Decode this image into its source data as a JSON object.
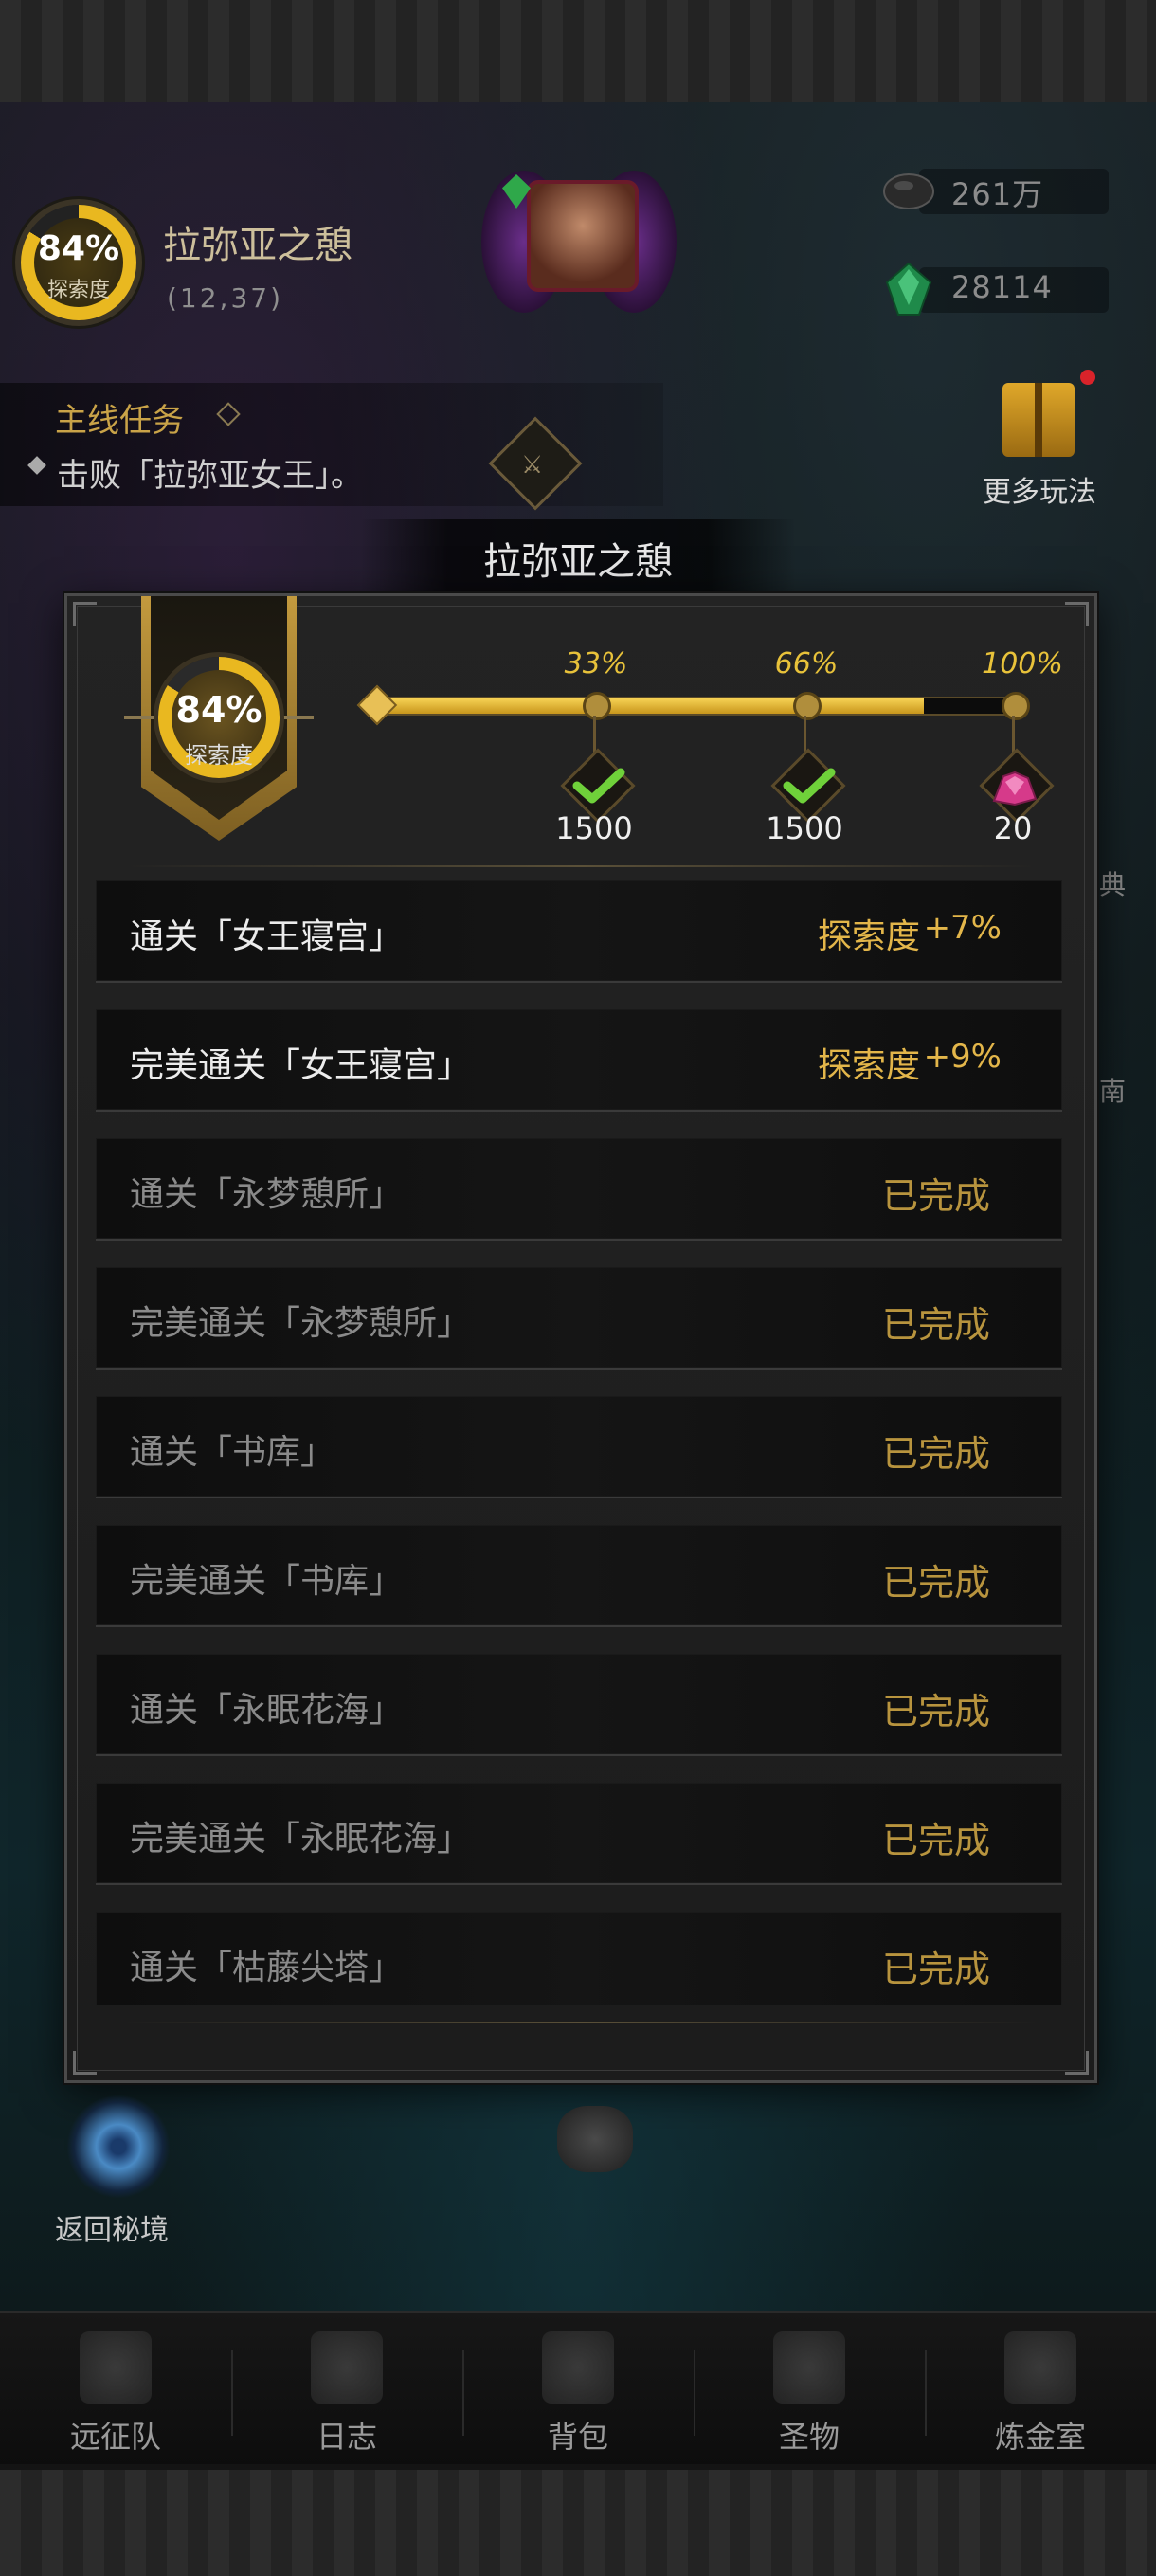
{
  "header": {
    "explore_pct": "84%",
    "explore_label": "探索度",
    "zone_name": "拉弥亚之憩",
    "zone_coords": "(12,37)",
    "currency_1": "261万",
    "currency_2": "28114"
  },
  "quest": {
    "title": "主线任务",
    "desc": "击败「拉弥亚女王」。"
  },
  "side": {
    "more_play_label": "更多玩法",
    "frag_1": "典",
    "frag_2": "南"
  },
  "dialog": {
    "title": "拉弥亚之憩",
    "explore_pct": "84%",
    "explore_label": "探索度",
    "progress": 0.84,
    "milestones": [
      {
        "pct": "33%",
        "qty": "1500",
        "claimed": true
      },
      {
        "pct": "66%",
        "qty": "1500",
        "claimed": true
      },
      {
        "pct": "100%",
        "qty": "20",
        "claimed": false
      }
    ],
    "reward_label": "探索度",
    "tasks": [
      {
        "name": "通关「女王寝宫」",
        "reward": "+7%",
        "done": false
      },
      {
        "name": "完美通关「女王寝宫」",
        "reward": "+9%",
        "done": false
      },
      {
        "name": "通关「永梦憩所」",
        "status": "已完成",
        "done": true
      },
      {
        "name": "完美通关「永梦憩所」",
        "status": "已完成",
        "done": true
      },
      {
        "name": "通关「书库」",
        "status": "已完成",
        "done": true
      },
      {
        "name": "完美通关「书库」",
        "status": "已完成",
        "done": true
      },
      {
        "name": "通关「永眠花海」",
        "status": "已完成",
        "done": true
      },
      {
        "name": "完美通关「永眠花海」",
        "status": "已完成",
        "done": true
      },
      {
        "name": "通关「枯藤尖塔」",
        "status": "已完成",
        "done": true
      }
    ]
  },
  "return_label": "返回秘境",
  "nav": [
    {
      "label": "远征队",
      "icon": "helmet-icon"
    },
    {
      "label": "日志",
      "icon": "scroll-icon"
    },
    {
      "label": "背包",
      "icon": "bag-icon"
    },
    {
      "label": "圣物",
      "icon": "brazier-icon"
    },
    {
      "label": "炼金室",
      "icon": "alchemy-icon"
    }
  ],
  "colors": {
    "accent_gold": "#e3b64a",
    "done_gold": "#b8943e",
    "progress_fill": "#f6d254"
  }
}
